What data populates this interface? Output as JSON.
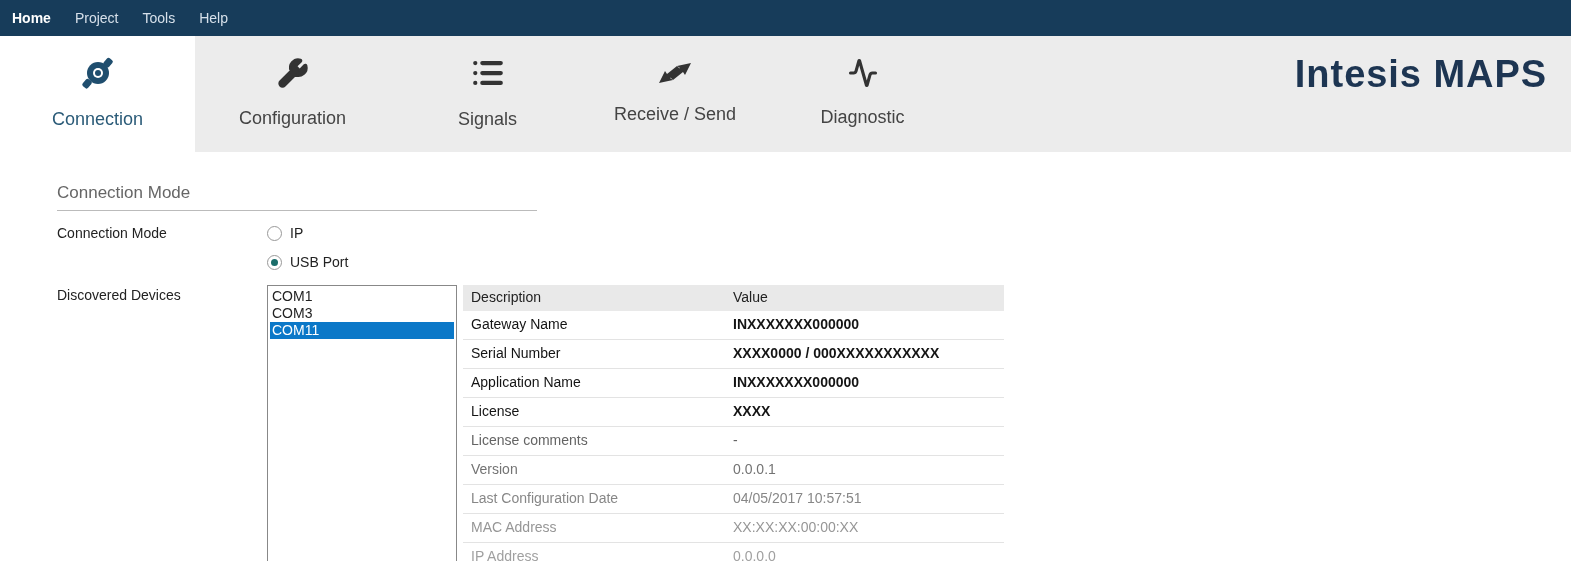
{
  "menu": [
    {
      "label": "Home",
      "selected": true
    },
    {
      "label": "Project",
      "selected": false
    },
    {
      "label": "Tools",
      "selected": false
    },
    {
      "label": "Help",
      "selected": false
    }
  ],
  "tabs": [
    {
      "label": "Connection",
      "kind": "connection",
      "selected": true
    },
    {
      "label": "Configuration",
      "kind": "wrench",
      "selected": false
    },
    {
      "label": "Signals",
      "kind": "list",
      "selected": false
    },
    {
      "label": "Receive / Send",
      "kind": "arrows",
      "selected": false
    },
    {
      "label": "Diagnostic",
      "kind": "pulse",
      "selected": false
    }
  ],
  "brand": "Intesis MAPS",
  "section_title": "Connection Mode",
  "connection_mode": {
    "label": "Connection Mode",
    "options": [
      {
        "label": "IP",
        "selected": false
      },
      {
        "label": "USB Port",
        "selected": true
      }
    ]
  },
  "devices": {
    "label": "Discovered Devices",
    "items": [
      {
        "label": "COM1",
        "selected": false
      },
      {
        "label": "COM3",
        "selected": false
      },
      {
        "label": "COM11",
        "selected": true
      }
    ]
  },
  "table": {
    "columns": [
      "Description",
      "Value"
    ],
    "rows": [
      [
        "Gateway Name",
        "INXXXXXXX000000"
      ],
      [
        "Serial Number",
        "XXXX0000 / 000XXXXXXXXXXX"
      ],
      [
        "Application Name",
        "INXXXXXXX000000"
      ],
      [
        "License",
        "XXXX"
      ],
      [
        "License comments",
        "-"
      ],
      [
        "Version",
        "0.0.0.1"
      ],
      [
        "Last Configuration Date",
        "04/05/2017 10:57:51"
      ],
      [
        "MAC Address",
        "XX:XX:XX:00:00:XX"
      ],
      [
        "IP Address",
        "0.0.0.0"
      ]
    ]
  }
}
